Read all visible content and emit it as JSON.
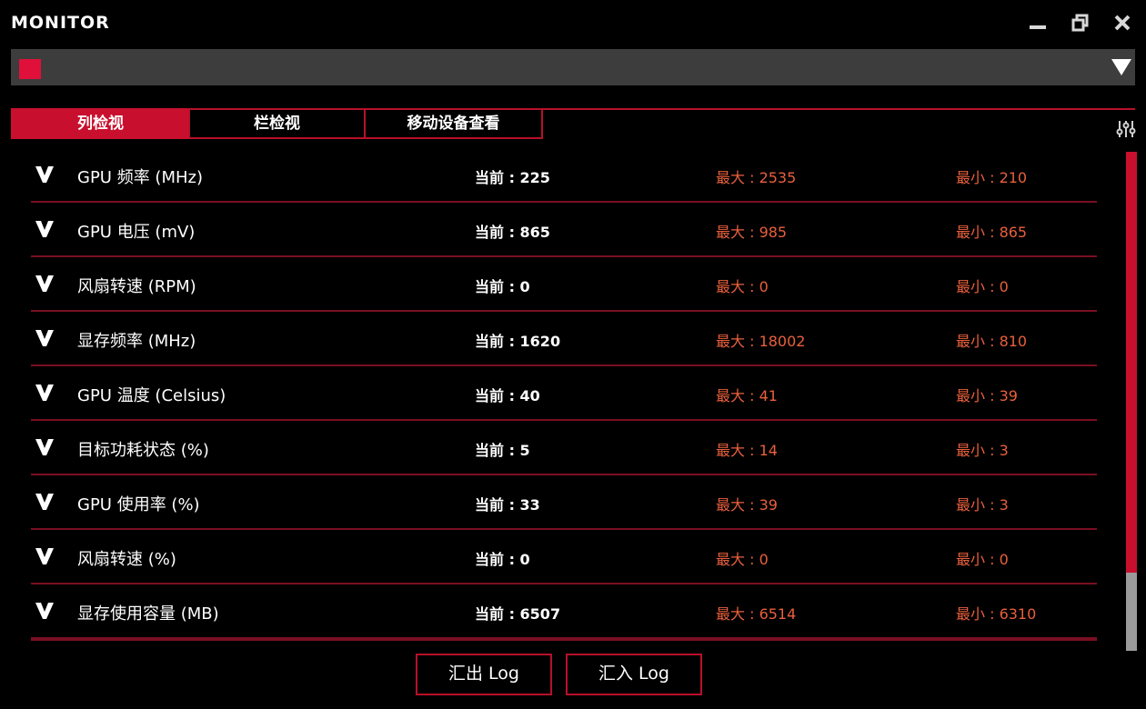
{
  "window": {
    "title": "MONITOR",
    "controls": [
      "minimize-icon",
      "restore-icon",
      "close-icon"
    ]
  },
  "device": {
    "swatch_color": "#e0103a",
    "dropdown_icon": "triangle-down-icon"
  },
  "tabs": [
    {
      "label": "列检视",
      "active": true
    },
    {
      "label": "栏检视",
      "active": false
    },
    {
      "label": "移动设备查看",
      "active": false
    }
  ],
  "colors": {
    "accent": "#c8102e",
    "max_min_text": "#e8603c",
    "row_divider": "#7a0f22"
  },
  "rows": [
    {
      "label": "GPU 频率 (MHz)",
      "current": "当前 : 225",
      "max": "最大 : 2535",
      "min": "最小 : 210"
    },
    {
      "label": "GPU 电压 (mV)",
      "current": "当前 : 865",
      "max": "最大 : 985",
      "min": "最小 : 865"
    },
    {
      "label": "风扇转速 (RPM)",
      "current": "当前 : 0",
      "max": "最大 : 0",
      "min": "最小 : 0"
    },
    {
      "label": "显存频率 (MHz)",
      "current": "当前 : 1620",
      "max": "最大 : 18002",
      "min": "最小 : 810"
    },
    {
      "label": "GPU 温度 (Celsius)",
      "current": "当前 : 40",
      "max": "最大 : 41",
      "min": "最小 : 39"
    },
    {
      "label": "目标功耗状态 (%)",
      "current": "当前 : 5",
      "max": "最大 : 14",
      "min": "最小 : 3"
    },
    {
      "label": "GPU 使用率 (%)",
      "current": "当前 : 33",
      "max": "最大 : 39",
      "min": "最小 : 3"
    },
    {
      "label": "风扇转速 (%)",
      "current": "当前 : 0",
      "max": "最大 : 0",
      "min": "最小 : 0"
    },
    {
      "label": "显存使用容量 (MB)",
      "current": "当前 : 6507",
      "max": "最大 : 6514",
      "min": "最小 : 6310"
    }
  ],
  "actions": {
    "export_label": "汇出 Log",
    "import_label": "汇入 Log"
  }
}
